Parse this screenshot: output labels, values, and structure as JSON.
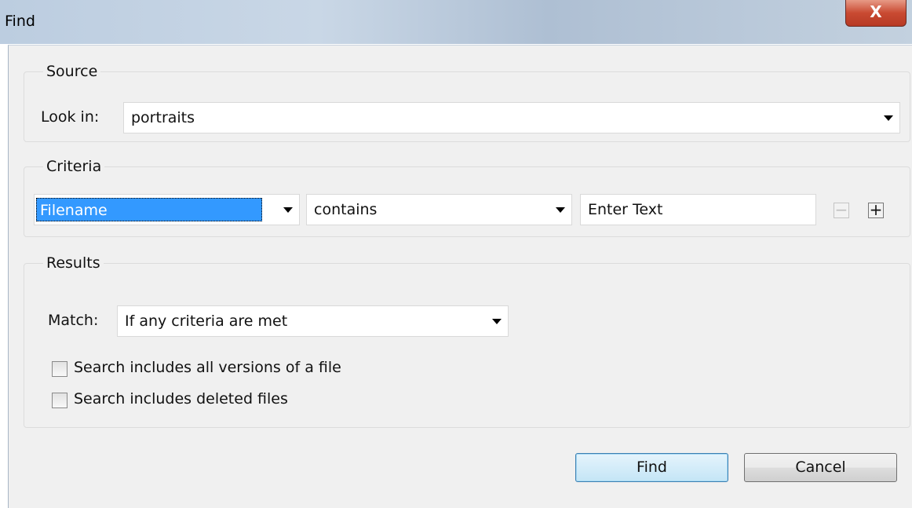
{
  "window": {
    "title": "Find",
    "close_label": "X"
  },
  "source": {
    "legend": "Source",
    "look_in_label": "Look in:",
    "look_in_value": "portraits"
  },
  "criteria": {
    "legend": "Criteria",
    "field_value": "Filename",
    "operator_value": "contains",
    "text_placeholder": "Enter Text",
    "remove_label": "−",
    "add_label": "+"
  },
  "results": {
    "legend": "Results",
    "match_label": "Match:",
    "match_value": "If any criteria are met",
    "options": [
      {
        "label": "Search includes all versions of a file",
        "checked": false
      },
      {
        "label": "Search includes deleted files",
        "checked": false
      }
    ]
  },
  "buttons": {
    "find": "Find",
    "cancel": "Cancel"
  },
  "icons": {
    "dropdown": "chevron-down-icon",
    "close": "close-icon"
  }
}
